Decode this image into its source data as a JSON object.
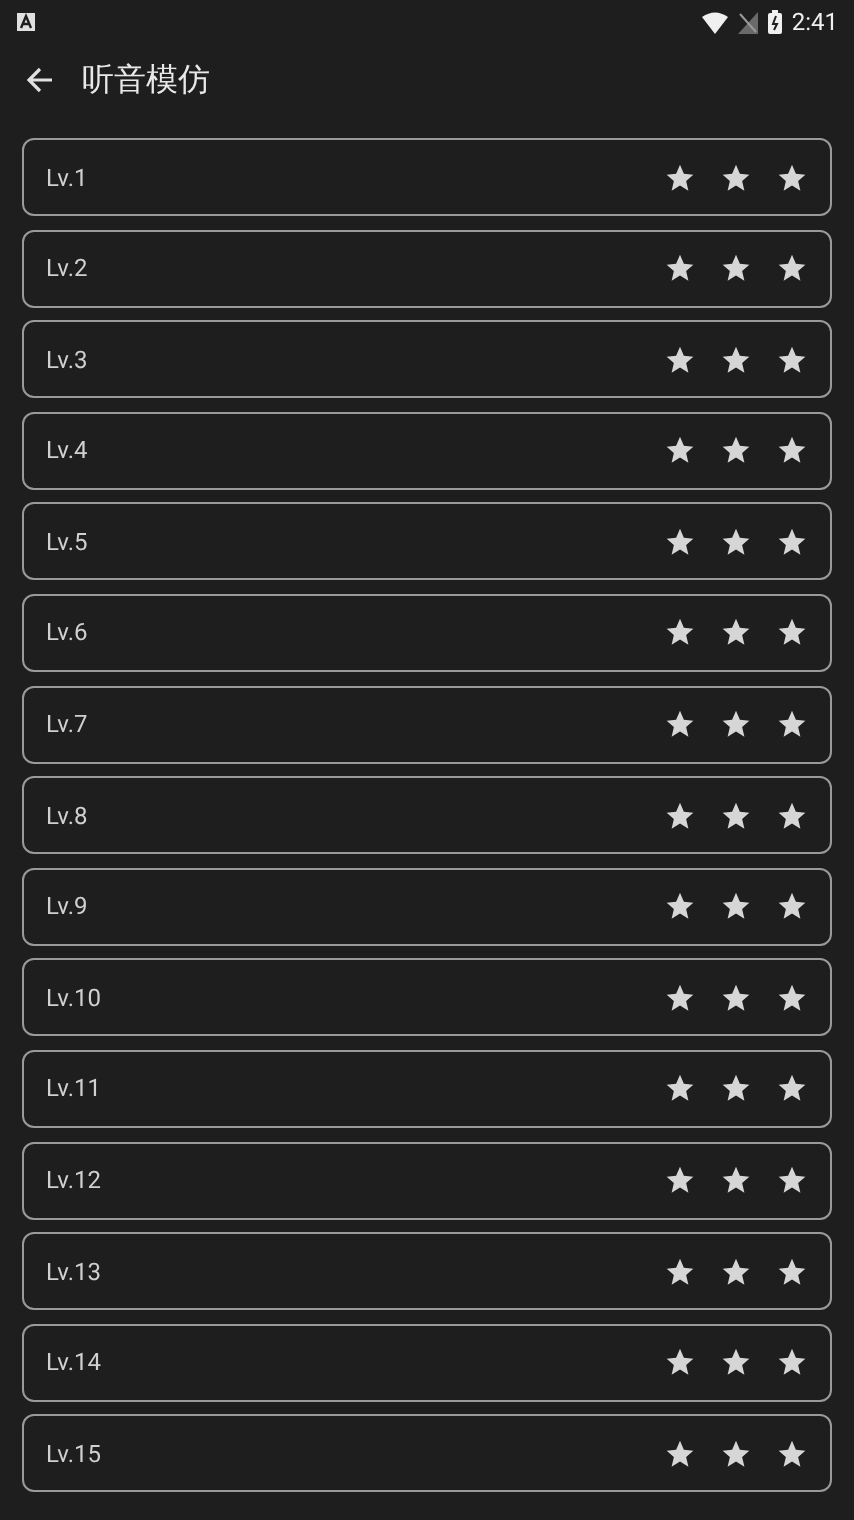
{
  "status_bar": {
    "time": "2:41"
  },
  "header": {
    "title": "听音模仿"
  },
  "levels": [
    {
      "label": "Lv.1",
      "stars": 3
    },
    {
      "label": "Lv.2",
      "stars": 3
    },
    {
      "label": "Lv.3",
      "stars": 3
    },
    {
      "label": "Lv.4",
      "stars": 3
    },
    {
      "label": "Lv.5",
      "stars": 3
    },
    {
      "label": "Lv.6",
      "stars": 3
    },
    {
      "label": "Lv.7",
      "stars": 3
    },
    {
      "label": "Lv.8",
      "stars": 3
    },
    {
      "label": "Lv.9",
      "stars": 3
    },
    {
      "label": "Lv.10",
      "stars": 3
    },
    {
      "label": "Lv.11",
      "stars": 3
    },
    {
      "label": "Lv.12",
      "stars": 3
    },
    {
      "label": "Lv.13",
      "stars": 3
    },
    {
      "label": "Lv.14",
      "stars": 3
    },
    {
      "label": "Lv.15",
      "stars": 3
    }
  ]
}
